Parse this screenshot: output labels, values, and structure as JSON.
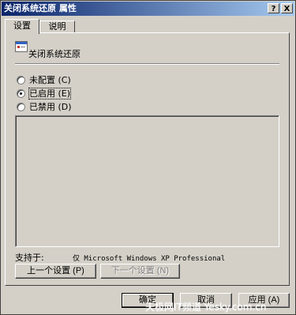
{
  "window": {
    "title": "关闭系统还原 属性",
    "help_label": "?",
    "close_label": "X"
  },
  "tabs": [
    {
      "label": "设置",
      "active": true
    },
    {
      "label": "说明",
      "active": false
    }
  ],
  "policy": {
    "name": "关闭系统还原",
    "icon": "policy-setting-icon"
  },
  "options": [
    {
      "label": "未配置 (C)",
      "selected": false
    },
    {
      "label": "已启用 (E)",
      "selected": true
    },
    {
      "label": "已禁用 (D)",
      "selected": false
    }
  ],
  "support": {
    "label": "支持于:",
    "value": "仅 Microsoft Windows XP Professional"
  },
  "nav": {
    "prev_label": "上一个设置 (P)",
    "next_label": "下一个设置 (N)"
  },
  "footer": {
    "ok_label": "确定",
    "cancel_label": "取消",
    "apply_label": "应用 (A)"
  },
  "watermark": "天极网IT频道 Yesky.com.cn",
  "colors": {
    "titlebar_start": "#0a246a",
    "titlebar_end": "#a6caf0",
    "face": "#d4d0c8"
  }
}
